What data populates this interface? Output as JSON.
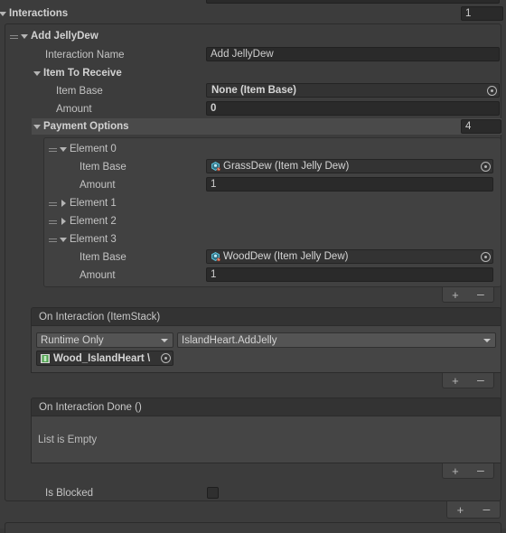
{
  "window": {
    "theme": "unity-dark",
    "accent": "#3c3c3c",
    "field_bg": "#2a2a2a",
    "header_bg": "#333333"
  },
  "interactions": {
    "label": "Interactions",
    "size_value": "1",
    "element": {
      "title": "Add JellyDew",
      "interaction_name_label": "Interaction Name",
      "interaction_name_value": "Add JellyDew",
      "item_to_receive": {
        "label": "Item To Receive",
        "item_base_label": "Item Base",
        "item_base_value": "None (Item Base)",
        "amount_label": "Amount",
        "amount_value": "0"
      },
      "payment_options": {
        "label": "Payment Options",
        "size_value": "4",
        "elements": [
          {
            "label": "Element 0",
            "expanded": true,
            "item_base_label": "Item Base",
            "item_base_value": "GrassDew (Item Jelly Dew)",
            "amount_label": "Amount",
            "amount_value": "1"
          },
          {
            "label": "Element 1",
            "expanded": false
          },
          {
            "label": "Element 2",
            "expanded": false
          },
          {
            "label": "Element 3",
            "expanded": true,
            "item_base_label": "Item Base",
            "item_base_value": "WoodDew (Item Jelly Dew)",
            "amount_label": "Amount",
            "amount_value": "1"
          }
        ]
      },
      "on_interaction": {
        "header": "On Interaction (ItemStack)",
        "call_state": "Runtime Only",
        "function": "IslandHeart.AddJelly",
        "target_object": "Wood_IslandHeart \\"
      },
      "on_interaction_done": {
        "header": "On Interaction Done ()",
        "empty_text": "List is Empty"
      },
      "is_blocked": {
        "label": "Is Blocked",
        "checked": false
      }
    }
  },
  "buttons": {
    "add": "+",
    "remove": "–"
  }
}
